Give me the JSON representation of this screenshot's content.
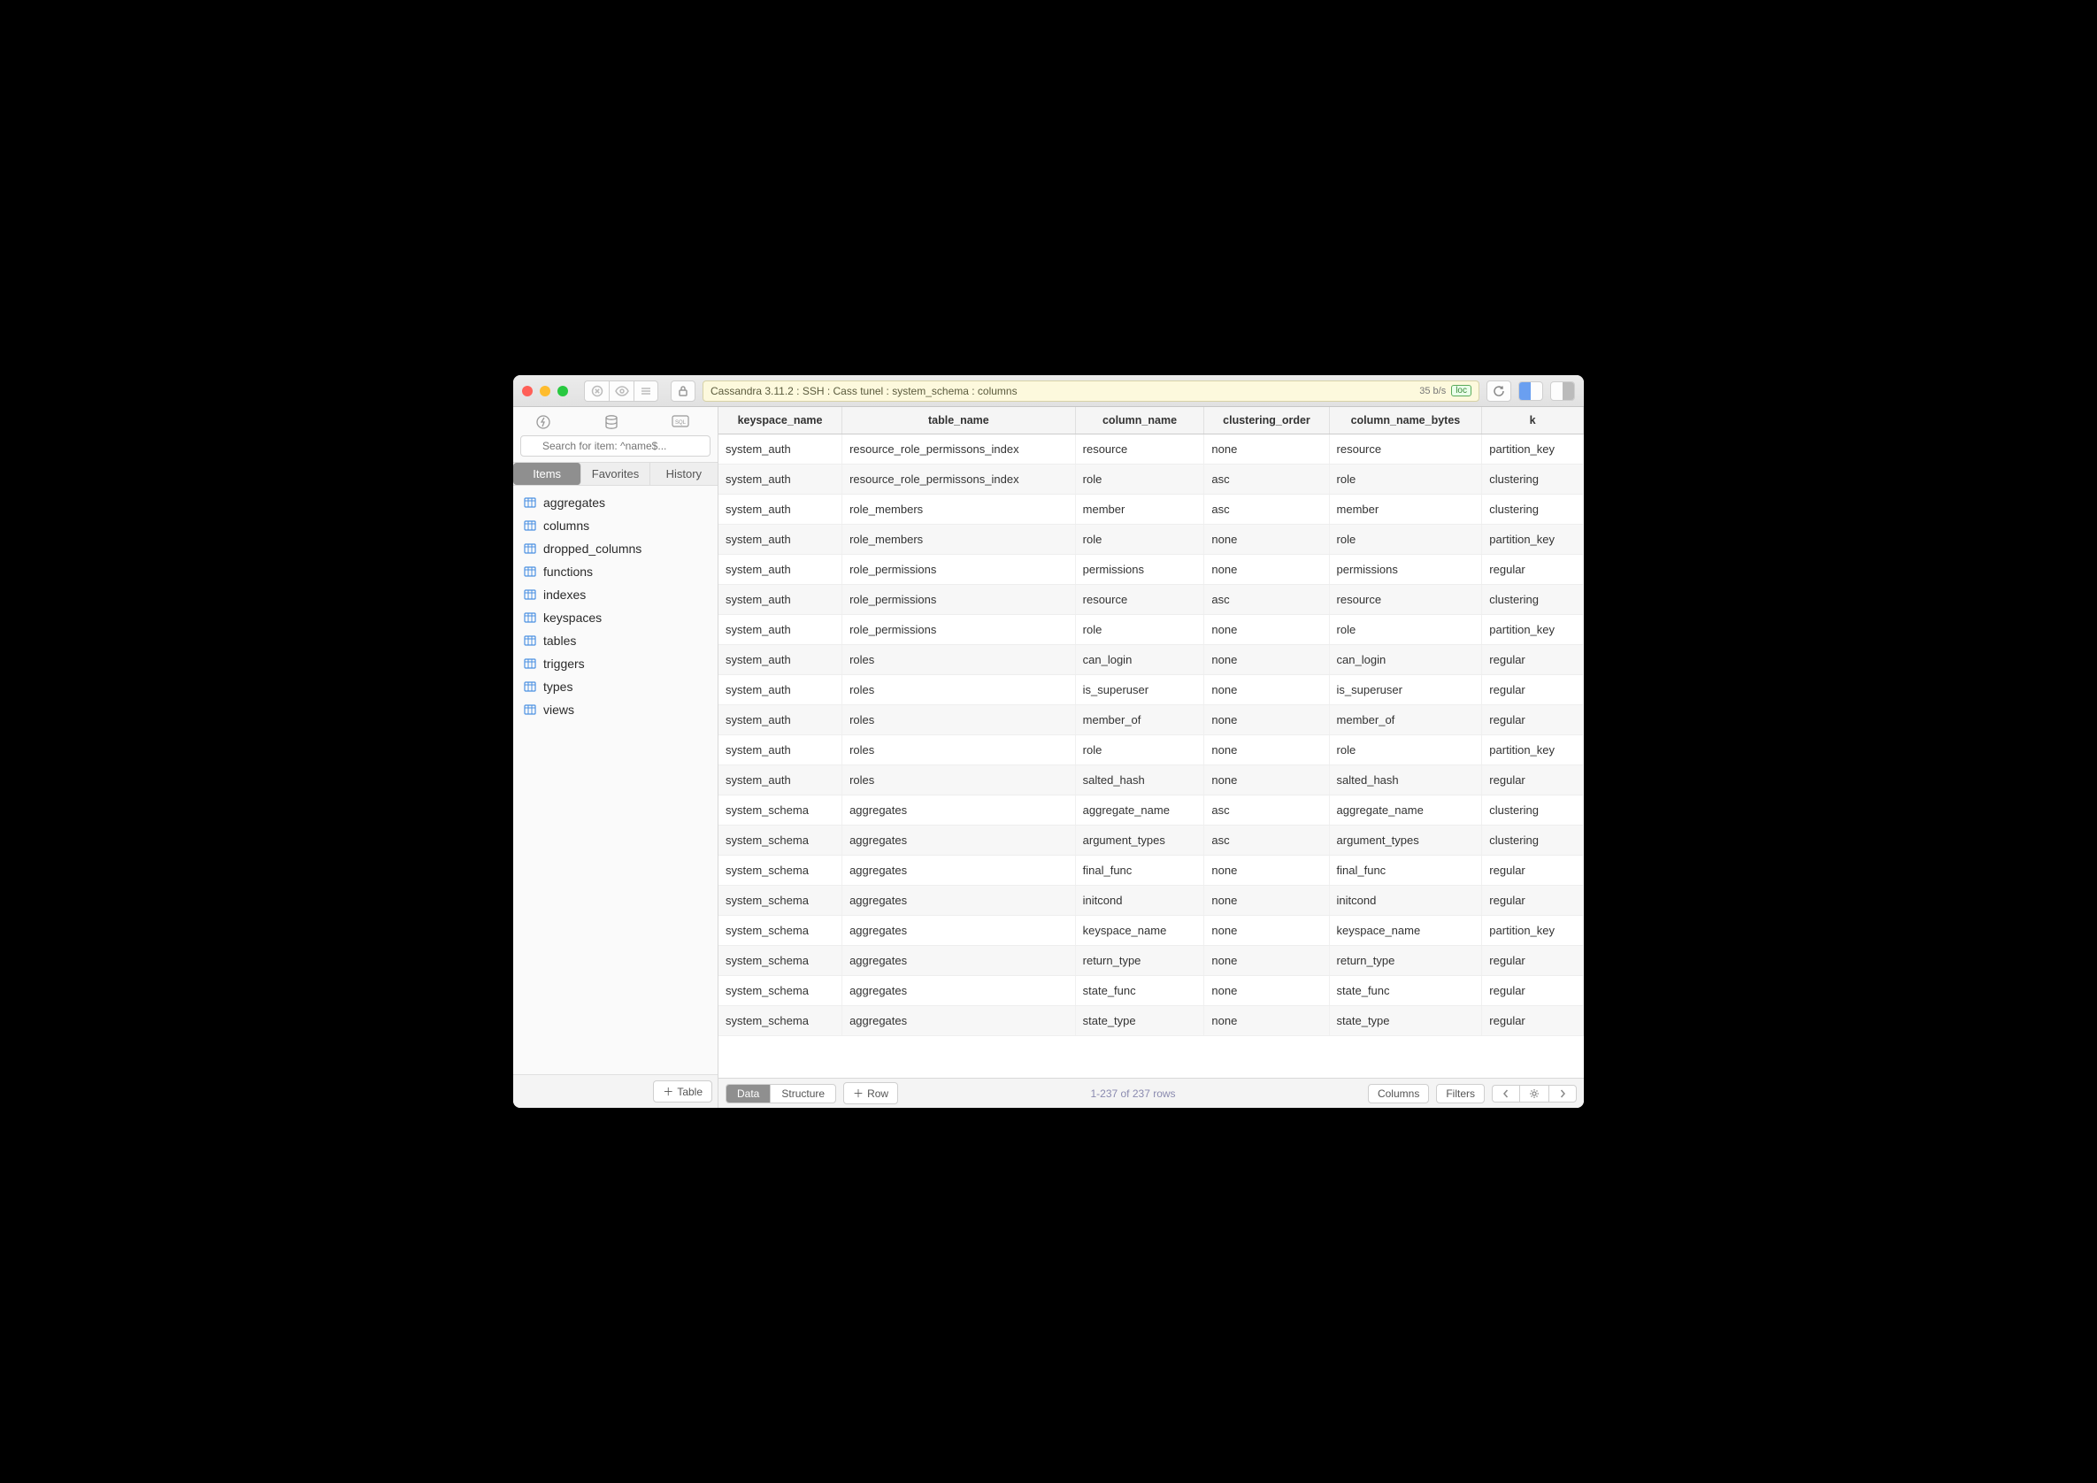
{
  "titlebar": {
    "breadcrumb": "Cassandra 3.11.2 : SSH : Cass tunel : system_schema : columns",
    "rate": "35 b/s",
    "loc": "loc"
  },
  "sidebar": {
    "search_placeholder": "Search for item: ^name$...",
    "tabs": {
      "items": "Items",
      "favorites": "Favorites",
      "history": "History"
    },
    "tree": [
      "aggregates",
      "columns",
      "dropped_columns",
      "functions",
      "indexes",
      "keyspaces",
      "tables",
      "triggers",
      "types",
      "views"
    ],
    "add_table": "Table"
  },
  "grid": {
    "columns": [
      "keyspace_name",
      "table_name",
      "column_name",
      "clustering_order",
      "column_name_bytes",
      "k"
    ],
    "rows": [
      [
        "system_auth",
        "resource_role_permissons_index",
        "resource",
        "none",
        "resource",
        "partition_key"
      ],
      [
        "system_auth",
        "resource_role_permissons_index",
        "role",
        "asc",
        "role",
        "clustering"
      ],
      [
        "system_auth",
        "role_members",
        "member",
        "asc",
        "member",
        "clustering"
      ],
      [
        "system_auth",
        "role_members",
        "role",
        "none",
        "role",
        "partition_key"
      ],
      [
        "system_auth",
        "role_permissions",
        "permissions",
        "none",
        "permissions",
        "regular"
      ],
      [
        "system_auth",
        "role_permissions",
        "resource",
        "asc",
        "resource",
        "clustering"
      ],
      [
        "system_auth",
        "role_permissions",
        "role",
        "none",
        "role",
        "partition_key"
      ],
      [
        "system_auth",
        "roles",
        "can_login",
        "none",
        "can_login",
        "regular"
      ],
      [
        "system_auth",
        "roles",
        "is_superuser",
        "none",
        "is_superuser",
        "regular"
      ],
      [
        "system_auth",
        "roles",
        "member_of",
        "none",
        "member_of",
        "regular"
      ],
      [
        "system_auth",
        "roles",
        "role",
        "none",
        "role",
        "partition_key"
      ],
      [
        "system_auth",
        "roles",
        "salted_hash",
        "none",
        "salted_hash",
        "regular"
      ],
      [
        "system_schema",
        "aggregates",
        "aggregate_name",
        "asc",
        "aggregate_name",
        "clustering"
      ],
      [
        "system_schema",
        "aggregates",
        "argument_types",
        "asc",
        "argument_types",
        "clustering"
      ],
      [
        "system_schema",
        "aggregates",
        "final_func",
        "none",
        "final_func",
        "regular"
      ],
      [
        "system_schema",
        "aggregates",
        "initcond",
        "none",
        "initcond",
        "regular"
      ],
      [
        "system_schema",
        "aggregates",
        "keyspace_name",
        "none",
        "keyspace_name",
        "partition_key"
      ],
      [
        "system_schema",
        "aggregates",
        "return_type",
        "none",
        "return_type",
        "regular"
      ],
      [
        "system_schema",
        "aggregates",
        "state_func",
        "none",
        "state_func",
        "regular"
      ],
      [
        "system_schema",
        "aggregates",
        "state_type",
        "none",
        "state_type",
        "regular"
      ]
    ]
  },
  "footer": {
    "data": "Data",
    "structure": "Structure",
    "row": "Row",
    "counter": "1-237 of 237 rows",
    "columns": "Columns",
    "filters": "Filters"
  }
}
